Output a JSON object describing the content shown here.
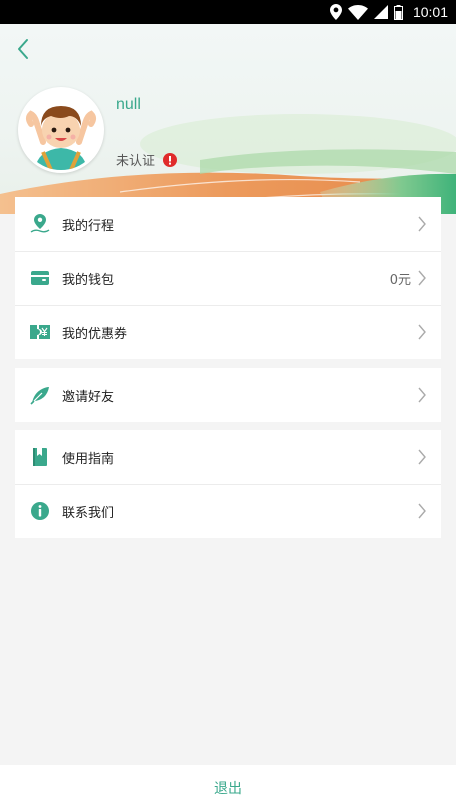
{
  "status_bar": {
    "time": "10:01"
  },
  "profile": {
    "username": "null",
    "verify_status": "未认证"
  },
  "menu_groups": [
    [
      {
        "label": "我的行程",
        "value": "",
        "icon": "location-pin-icon"
      },
      {
        "label": "我的钱包",
        "value": "0元",
        "icon": "wallet-icon"
      },
      {
        "label": "我的优惠券",
        "value": "",
        "icon": "coupon-icon"
      }
    ],
    [
      {
        "label": "邀请好友",
        "value": "",
        "icon": "feather-icon"
      }
    ],
    [
      {
        "label": "使用指南",
        "value": "",
        "icon": "book-icon"
      },
      {
        "label": "联系我们",
        "value": "",
        "icon": "info-icon"
      }
    ]
  ],
  "footer": {
    "logout_label": "退出"
  },
  "colors": {
    "accent": "#3aa88c",
    "warning": "#e02b2b"
  }
}
